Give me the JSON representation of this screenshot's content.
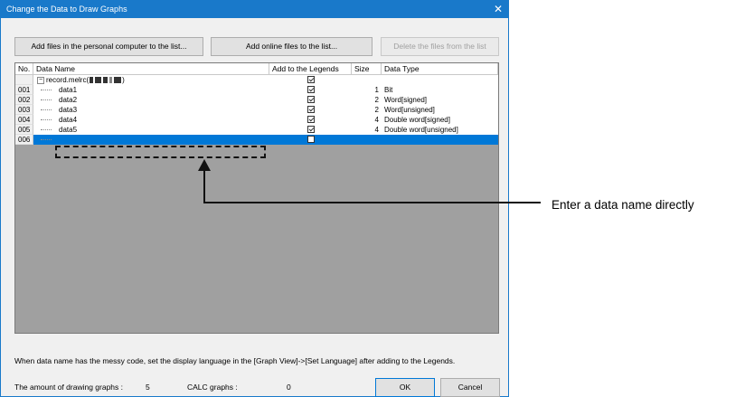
{
  "dialog": {
    "title": "Change the Data to Draw Graphs",
    "close_glyph": "✕",
    "buttons": {
      "add_pc": "Add files in the personal computer to the list...",
      "add_online": "Add online files to the list...",
      "delete": "Delete the files from the list"
    },
    "columns": {
      "no": "No.",
      "data_name": "Data Name",
      "legends": "Add to the Legends",
      "size": "Size",
      "data_type": "Data Type"
    },
    "file_row": {
      "label": "record.melrc(",
      "suffix": ")",
      "add_to_legends": true
    },
    "rows": [
      {
        "no": "001",
        "name": "data1",
        "add_to_legends": true,
        "size": "1",
        "type": "Bit"
      },
      {
        "no": "002",
        "name": "data2",
        "add_to_legends": true,
        "size": "2",
        "type": "Word[signed]"
      },
      {
        "no": "003",
        "name": "data3",
        "add_to_legends": true,
        "size": "2",
        "type": "Word[unsigned]"
      },
      {
        "no": "004",
        "name": "data4",
        "add_to_legends": true,
        "size": "4",
        "type": "Double word[signed]"
      },
      {
        "no": "005",
        "name": "data5",
        "add_to_legends": true,
        "size": "4",
        "type": "Double word[unsigned]"
      },
      {
        "no": "006",
        "name": "",
        "add_to_legends": false,
        "size": "",
        "type": "",
        "selected": true
      }
    ],
    "note": "When data name has the messy code, set the display language in the [Graph View]->[Set Language] after adding to the Legends.",
    "footer": {
      "drawing_graphs_label": "The amount of drawing graphs :",
      "drawing_graphs_value": "5",
      "calc_graphs_label": "CALC graphs :",
      "calc_graphs_value": "0",
      "ok": "OK",
      "cancel": "Cancel"
    }
  },
  "callout": {
    "text": "Enter a data name directly"
  },
  "colors": {
    "titlebar": "#1979ca",
    "selection": "#0078d7",
    "grid_background": "#a0a0a0"
  }
}
